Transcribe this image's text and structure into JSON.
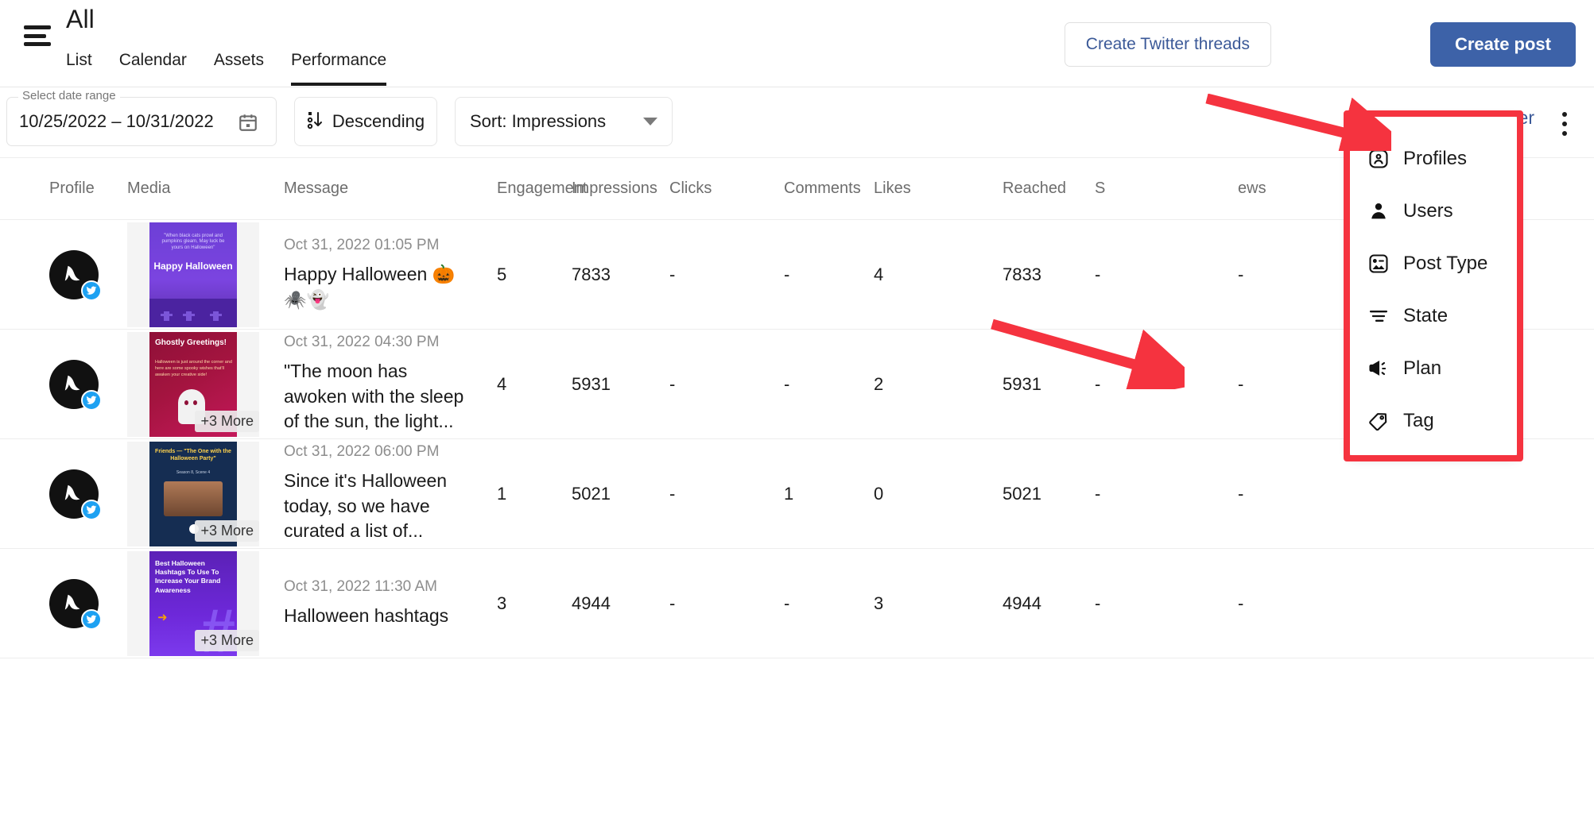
{
  "header": {
    "menu_icon": "hamburger-icon",
    "title": "All",
    "tabs": [
      {
        "label": "List",
        "active": false
      },
      {
        "label": "Calendar",
        "active": false
      },
      {
        "label": "Assets",
        "active": false
      },
      {
        "label": "Performance",
        "active": true
      }
    ],
    "create_threads_label": "Create Twitter threads",
    "create_post_label": "Create post",
    "accent_color": "#3d62a8",
    "link_color": "#3b5998"
  },
  "toolbar": {
    "date_legend": "Select date range",
    "date_value": "10/25/2022 – 10/31/2022",
    "calendar_icon": "calendar-icon",
    "sort_direction_label": "Descending",
    "sort_direction_icon": "sort-descending-icon",
    "sort_by_label": "Sort: Impressions",
    "add_filter_label": "Add filter",
    "add_filter_plus": "+",
    "more_options_icon": "kebab-menu-icon"
  },
  "filter_menu": {
    "highlight_color": "#f5333f",
    "items": [
      {
        "label": "Profiles",
        "icon": "profile-card-icon"
      },
      {
        "label": "Users",
        "icon": "user-icon"
      },
      {
        "label": "Post Type",
        "icon": "image-square-icon"
      },
      {
        "label": "State",
        "icon": "filter-lines-icon"
      },
      {
        "label": "Plan",
        "icon": "megaphone-icon"
      },
      {
        "label": "Tag",
        "icon": "tag-icon"
      }
    ]
  },
  "table": {
    "columns": [
      "Profile",
      "Media",
      "Message",
      "Engagement",
      "Impressions",
      "Clicks",
      "Comments",
      "Likes",
      "Reached",
      "S",
      "ews"
    ],
    "rows": [
      {
        "profile_icon": "bird-avatar",
        "network_badge": "twitter-icon",
        "media_more": "",
        "date": "Oct 31, 2022 01:05 PM",
        "message": "Happy Halloween 🎃🕷️👻",
        "engagement": "5",
        "impressions": "7833",
        "clicks": "-",
        "comments": "-",
        "likes": "4",
        "reached": "7833",
        "shares": "-",
        "views": "-",
        "thumb_title": "Happy Halloween",
        "thumb_quote": "\"When black cats prowl and pumpkins gleam, May luck be yours on Halloween\""
      },
      {
        "profile_icon": "bird-avatar",
        "network_badge": "twitter-icon",
        "media_more": "+3 More",
        "date": "Oct 31, 2022 04:30 PM",
        "message": "\"The moon has awoken with the sleep of the sun, the light...",
        "engagement": "4",
        "impressions": "5931",
        "clicks": "-",
        "comments": "-",
        "likes": "2",
        "reached": "5931",
        "shares": "-",
        "views": "-",
        "thumb_title": "Ghostly Greetings!",
        "thumb_quote": "Halloween is just around the corner and here are some spooky wishes that'll awaken your creative side!"
      },
      {
        "profile_icon": "bird-avatar",
        "network_badge": "twitter-icon",
        "media_more": "+3 More",
        "date": "Oct 31, 2022 06:00 PM",
        "message": "Since it's Halloween today, so we have curated a list of...",
        "engagement": "1",
        "impressions": "5021",
        "clicks": "-",
        "comments": "1",
        "likes": "0",
        "reached": "5021",
        "shares": "-",
        "views": "-",
        "thumb_title": "Friends — \"The One with the Halloween Party\"",
        "thumb_quote": "Season 8, Scene 4"
      },
      {
        "profile_icon": "bird-avatar",
        "network_badge": "twitter-icon",
        "media_more": "+3 More",
        "date": "Oct 31, 2022 11:30 AM",
        "message": "Halloween hashtags",
        "engagement": "3",
        "impressions": "4944",
        "clicks": "-",
        "comments": "-",
        "likes": "3",
        "reached": "4944",
        "shares": "-",
        "views": "-",
        "thumb_title": "Best Halloween Hashtags To Use To Increase Your Brand Awareness",
        "thumb_quote": ""
      }
    ]
  }
}
